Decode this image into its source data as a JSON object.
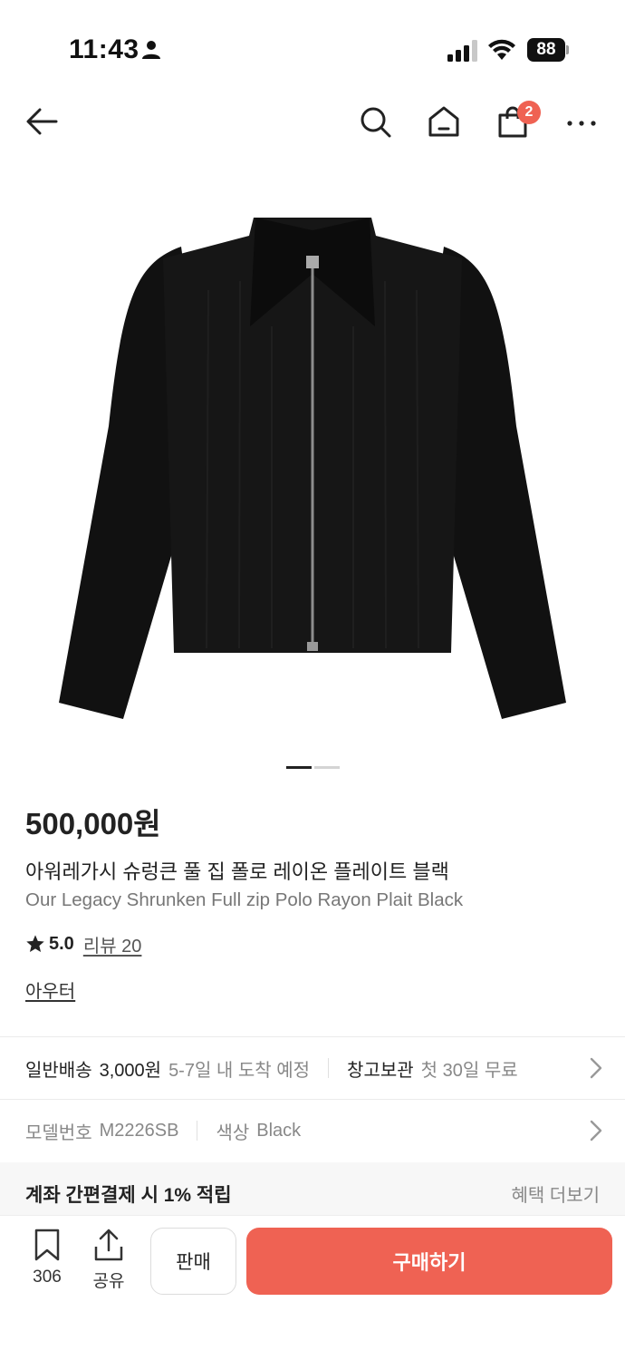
{
  "status_bar": {
    "time": "11:43",
    "battery": "88"
  },
  "nav": {
    "cart_badge": "2"
  },
  "product": {
    "price": "500,000원",
    "name_ko": "아워레가시 슈렁큰 풀 집 폴로 레이온 플레이트 블랙",
    "name_en": "Our Legacy Shrunken Full zip Polo Rayon Plait Black",
    "rating": "5.0",
    "review_label": "리뷰 20",
    "category": "아우터"
  },
  "shipping": {
    "method": "일반배송",
    "fee": "3,000원",
    "eta": "5-7일 내 도착 예정",
    "storage_label": "창고보관",
    "storage_detail": "첫 30일 무료"
  },
  "specs": {
    "model_label": "모델번호",
    "model_value": "M2226SB",
    "color_label": "색상",
    "color_value": "Black"
  },
  "benefit": {
    "text": "계좌 간편결제 시 1% 적립",
    "more": "혜택 더보기"
  },
  "bottom": {
    "bookmark_count": "306",
    "share_label": "공유",
    "sell_label": "판매",
    "buy_label": "구매하기"
  },
  "colors": {
    "accent": "#ef6253"
  }
}
